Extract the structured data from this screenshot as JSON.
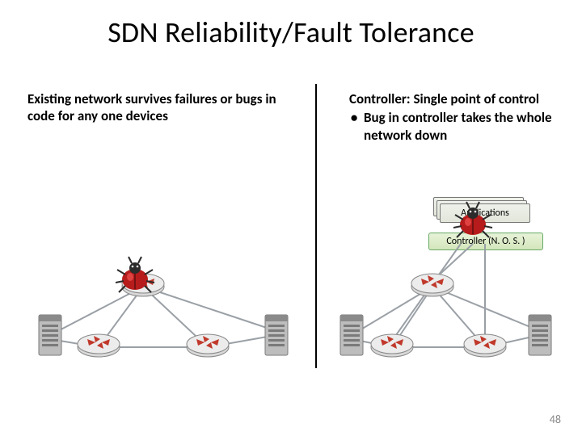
{
  "title": "SDN Reliability/Fault Tolerance",
  "left": {
    "text": "Existing network survives failures or bugs in code for any one devices"
  },
  "right": {
    "heading": "Controller: Single point of control",
    "bullet1": "Bug in controller takes the whole network down"
  },
  "boxes": {
    "applications": "Applications",
    "controller": "Controller (N. O. S. )"
  },
  "page_number": "48",
  "colors": {
    "router_red": "#c0392b",
    "server_gray": "#7a7a7a",
    "bug_body": "#b71c1c",
    "bug_shine": "#ef5350",
    "link": "#9aa0a6"
  }
}
